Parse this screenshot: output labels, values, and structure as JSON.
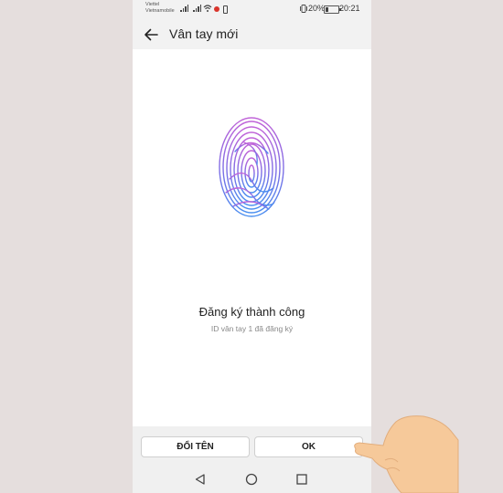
{
  "status_bar": {
    "carrier_1": "Viettel",
    "carrier_2": "Vietnamobile",
    "battery_percent": "20%",
    "battery_level": 0.2,
    "time": "20:21"
  },
  "app_bar": {
    "back_icon": "arrow-left-icon",
    "title": "Vân tay mới"
  },
  "main": {
    "fingerprint_icon": "fingerprint-icon",
    "fingerprint_gradient": [
      "#c063d8",
      "#7b6ee6",
      "#4a8ff0"
    ],
    "heading": "Đăng ký thành công",
    "subtext": "ID vân tay 1 đã đăng ký"
  },
  "actions": {
    "rename_label": "ĐỔI TÊN",
    "ok_label": "OK"
  },
  "nav_bar": {
    "back": "triangle-back-icon",
    "home": "circle-home-icon",
    "recents": "square-recents-icon"
  },
  "colors": {
    "page_background": "#e5dedd",
    "screen_background": "#ffffff",
    "hand": "#f6c99a"
  }
}
